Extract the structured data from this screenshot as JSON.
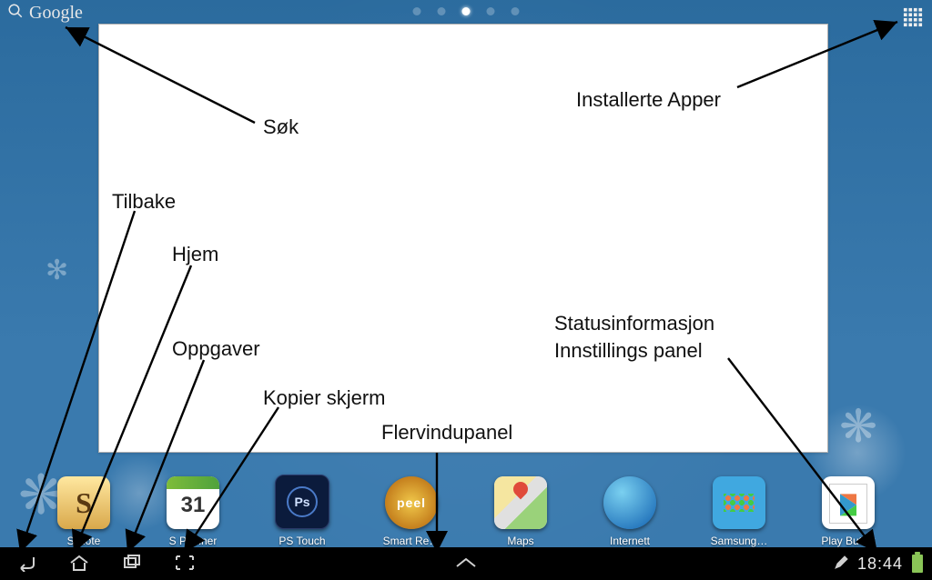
{
  "topbar": {
    "search_label": "Google",
    "page_count": 5,
    "active_page": 2
  },
  "annotations": {
    "search": "Søk",
    "installed_apps": "Installerte Apper",
    "back": "Tilbake",
    "home": "Hjem",
    "tasks": "Oppgaver",
    "screenshot": "Kopier skjerm",
    "multiwindow": "Flervindupanel",
    "status_panel": "Statusinformasjon\nInnstillings panel"
  },
  "dock": [
    {
      "label": "S Note",
      "icon": "snote",
      "letter": "S"
    },
    {
      "label": "S Planner",
      "icon": "splanner",
      "day": "31"
    },
    {
      "label": "PS Touch",
      "icon": "pstouch",
      "mark": "Ps"
    },
    {
      "label": "Smart Re…",
      "icon": "smartremote",
      "mark": "peel"
    },
    {
      "label": "Maps",
      "icon": "maps"
    },
    {
      "label": "Internett",
      "icon": "internet"
    },
    {
      "label": "Samsung…",
      "icon": "samsung"
    },
    {
      "label": "Play Butikk",
      "icon": "play"
    }
  ],
  "status": {
    "time": "18:44"
  }
}
